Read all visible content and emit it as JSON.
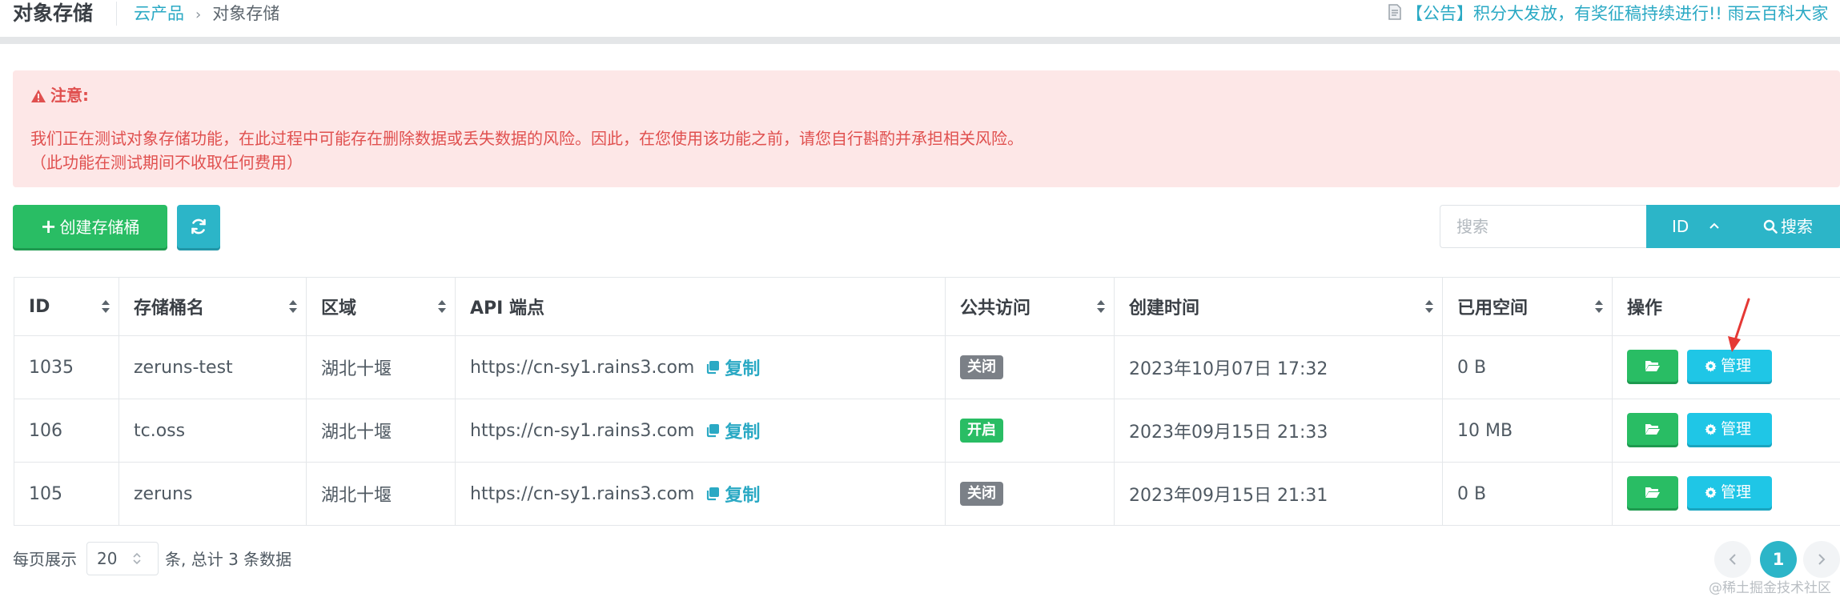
{
  "header": {
    "title": "对象存储",
    "breadcrumb": {
      "parent": "云产品",
      "current": "对象存储"
    },
    "announcement": "【公告】积分大发放，有奖征稿持续进行!! 雨云百科大家"
  },
  "alert": {
    "title": "注意:",
    "line1": "我们正在测试对象存储功能，在此过程中可能存在删除数据或丢失数据的风险。因此，在您使用该功能之前，请您自行斟酌并承担相关风险。",
    "line2": "（此功能在测试期间不收取任何费用）"
  },
  "toolbar": {
    "create_label": "创建存储桶",
    "search_placeholder": "搜索",
    "search_field": "ID",
    "search_label": "搜索"
  },
  "table": {
    "headers": {
      "id": "ID",
      "name": "存储桶名",
      "region": "区域",
      "endpoint": "API 端点",
      "public": "公共访问",
      "created": "创建时间",
      "used": "已用空间",
      "actions": "操作"
    },
    "copy_label": "复制",
    "manage_label": "管理",
    "rows": [
      {
        "id": "1035",
        "name": "zeruns-test",
        "region": "湖北十堰",
        "endpoint": "https://cn-sy1.rains3.com",
        "public": "关闭",
        "public_state": "off",
        "created": "2023年10月07日 17:32",
        "used": "0 B"
      },
      {
        "id": "106",
        "name": "tc.oss",
        "region": "湖北十堰",
        "endpoint": "https://cn-sy1.rains3.com",
        "public": "开启",
        "public_state": "on",
        "created": "2023年09月15日 21:33",
        "used": "10 MB"
      },
      {
        "id": "105",
        "name": "zeruns",
        "region": "湖北十堰",
        "endpoint": "https://cn-sy1.rains3.com",
        "public": "关闭",
        "public_state": "off",
        "created": "2023年09月15日 21:31",
        "used": "0 B"
      }
    ]
  },
  "footer": {
    "per_page_prefix": "每页展示",
    "per_page_value": "20",
    "summary": "条, 总计 3 条数据",
    "current_page": "1"
  },
  "watermark": "@稀土掘金技术社区",
  "colors": {
    "accent": "#2cb5c8",
    "success": "#29bd64",
    "manage": "#1fc6e6",
    "alert_bg": "#fde7e7",
    "alert_text": "#e0504f",
    "badge_off": "#7b8087",
    "annotation_arrow": "#e53935"
  },
  "icons": [
    "doc-icon",
    "warning-icon",
    "plus-icon",
    "refresh-icon",
    "chevron-up-icon",
    "search-icon",
    "sort-icon",
    "copy-icon",
    "folder-open-icon",
    "gear-icon",
    "chevron-left-icon",
    "chevron-right-icon",
    "chevron-updown-icon",
    "annotation-arrow"
  ]
}
